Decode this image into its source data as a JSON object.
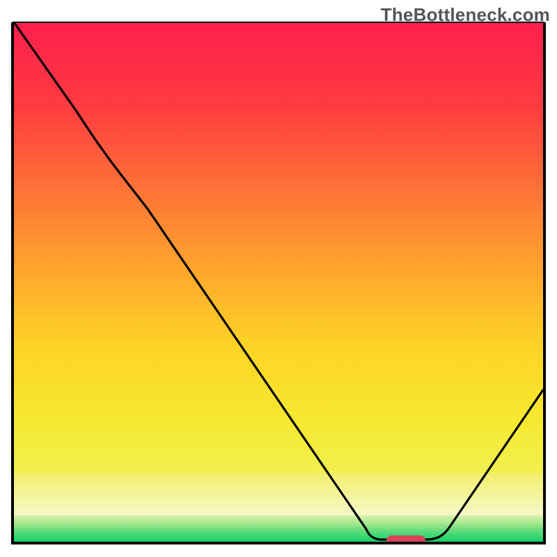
{
  "watermark": "TheBottleneck.com",
  "chart_data": {
    "type": "line",
    "title": "",
    "xlabel": "",
    "ylabel": "",
    "xlim": [
      0,
      100
    ],
    "ylim": [
      0,
      100
    ],
    "background_gradient": {
      "direction": "vertical",
      "stops": [
        {
          "pos": 0.0,
          "color": "#ff1f4d"
        },
        {
          "pos": 0.38,
          "color": "#ff7537"
        },
        {
          "pos": 0.72,
          "color": "#fdd425"
        },
        {
          "pos": 0.87,
          "color": "#f4f49a"
        },
        {
          "pos": 1.0,
          "color": "#12d26a"
        }
      ],
      "meaning": "red=high bottleneck, green=no bottleneck"
    },
    "series": [
      {
        "name": "bottleneck-curve",
        "color": "#000000",
        "x": [
          0,
          12,
          25,
          40,
          55,
          67,
          71,
          75,
          78,
          82,
          100
        ],
        "y": [
          100,
          83,
          63,
          40,
          18,
          2,
          0,
          0,
          2,
          6,
          27
        ]
      }
    ],
    "marker": {
      "name": "selected-config",
      "shape": "rounded-rect",
      "color": "#d9445a",
      "x_range": [
        71,
        78
      ],
      "y": 0
    },
    "annotations": [
      {
        "text": "TheBottleneck.com",
        "role": "watermark",
        "position": "top-right",
        "color": "#555559"
      }
    ]
  }
}
